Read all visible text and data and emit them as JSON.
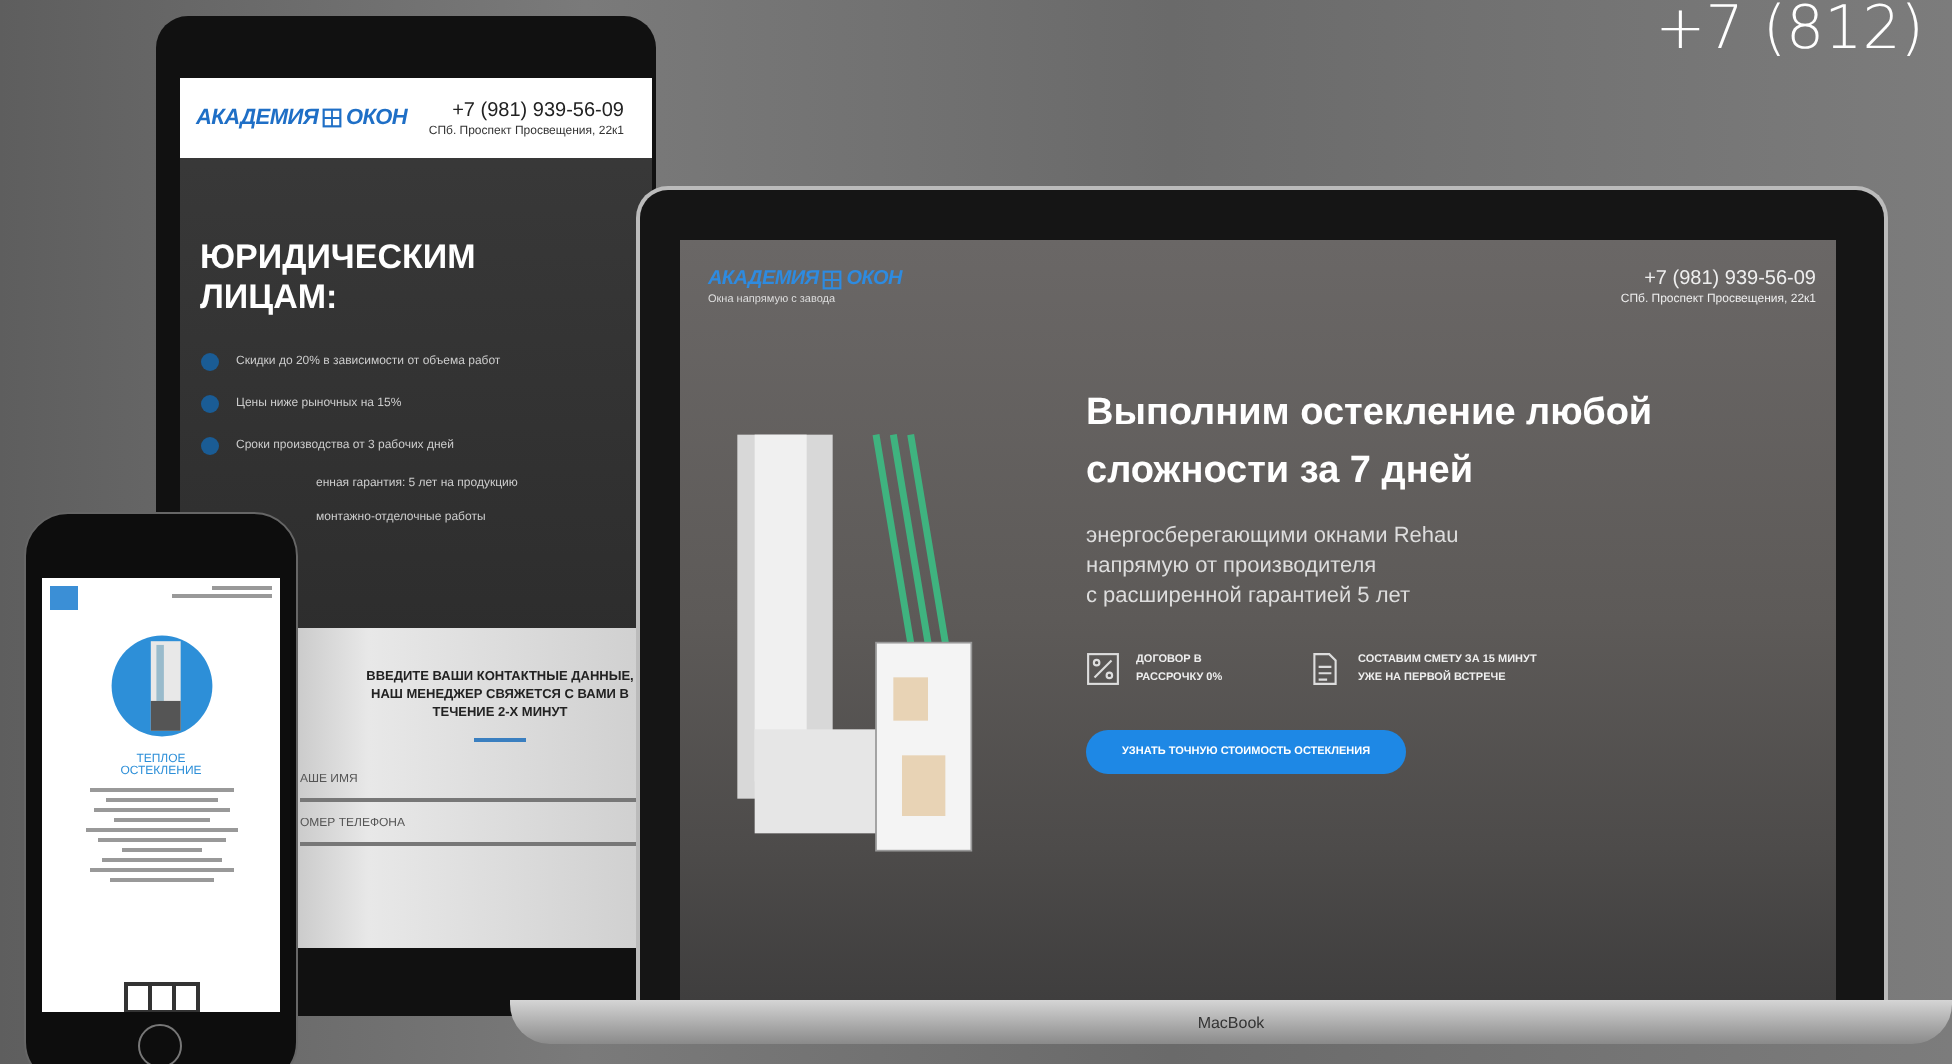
{
  "background": {
    "phone": "+7 (812)"
  },
  "tablet": {
    "logo": {
      "left": "АКАДЕМИЯ",
      "right": "ОКОН"
    },
    "phone": "+7 (981) 939-56-09",
    "address": "СПб. Проспект Просвещения, 22к1",
    "heading": "ЮРИДИЧЕСКИМ ЛИЦАМ:",
    "benefits": [
      {
        "text": "Скидки до 20% в зависимости от объема работ"
      },
      {
        "text": "Цены ниже рыночных на 15%"
      },
      {
        "text": "Сроки производства от 3 рабочих дней"
      },
      {
        "text": "енная гарантия: 5 лет на продукцию"
      },
      {
        "text": "монтажно-отделочные работы"
      }
    ],
    "form": {
      "title": "ВВЕДИТЕ ВАШИ КОНТАКТНЫЕ ДАННЫЕ, НАШ МЕНЕДЖЕР СВЯЖЕТСЯ С ВАМИ В ТЕЧЕНИЕ 2-Х МИНУТ",
      "fields": [
        {
          "placeholder": "АШЕ ИМЯ"
        },
        {
          "placeholder": "ОМЕР ТЕЛЕФОНА"
        }
      ]
    }
  },
  "phone": {
    "heading": "ТЕПЛОЕ ОСТЕКЛЕНИЕ"
  },
  "laptop": {
    "logo": {
      "left": "АКАДЕМИЯ",
      "right": "ОКОН"
    },
    "tagline": "Окна напрямую с завода",
    "phone": "+7 (981) 939-56-09",
    "address": "СПб. Проспект Просвещения, 22к1",
    "heading": "Выполним остекление любой сложности за 7 дней",
    "subtitle": [
      "энергосберегающими окнами Rehau",
      "напрямую от производителя",
      "с расширенной гарантией 5 лет"
    ],
    "features": [
      {
        "kind": "percent",
        "text": "ДОГОВОР В РАССРОЧКУ 0%"
      },
      {
        "kind": "document",
        "text": "СОСТАВИМ СМЕТУ ЗА 15 МИНУТ УЖЕ НА ПЕРВОЙ ВСТРЕЧЕ"
      }
    ],
    "button": "УЗНАТЬ ТОЧНУЮ СТОИМОСТЬ ОСТЕКЛЕНИЯ",
    "brand": "MacBook"
  }
}
